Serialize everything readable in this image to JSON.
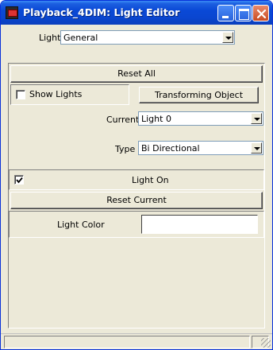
{
  "window": {
    "title": "Playback_4DIM: Light Editor",
    "icon": "app-window-icon"
  },
  "light_selector": {
    "label": "Light",
    "selected": "General"
  },
  "reset_all_label": "Reset All",
  "show_lights": {
    "label": "Show Lights",
    "checked": false
  },
  "transforming_object_label": "Transforming Object",
  "current": {
    "label": "Current",
    "selected": "Light 0"
  },
  "type": {
    "label": "Type",
    "selected": "Bi Directional"
  },
  "light_on": {
    "label": "Light On",
    "checked": true
  },
  "reset_current_label": "Reset Current",
  "light_color": {
    "label": "Light Color",
    "value": "#ffffff"
  }
}
